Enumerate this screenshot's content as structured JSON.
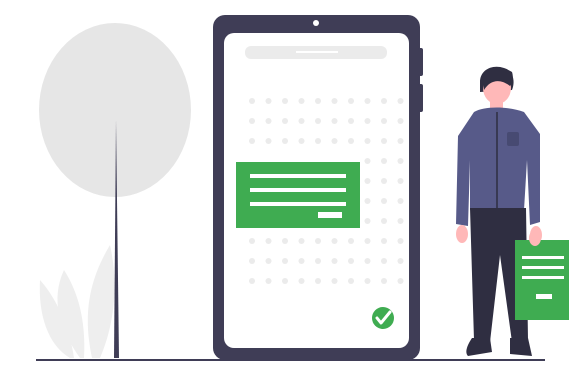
{
  "illustration": {
    "colors": {
      "phone_frame": "#3f3d56",
      "screen_bg": "#ffffff",
      "accent_green": "#3fac51",
      "dot_grid": "#ebebeb",
      "tree_foliage": "#e6e6e6",
      "tree_trunk": "#3f3d56",
      "ground_line": "#3f3d56",
      "person_shirt": "#575a89",
      "person_pants": "#2f2e41",
      "person_skin": "#ffb8b8",
      "person_hair": "#2f2e41",
      "check_mark": "#ffffff"
    },
    "icons": [
      "check-circle-icon"
    ]
  }
}
